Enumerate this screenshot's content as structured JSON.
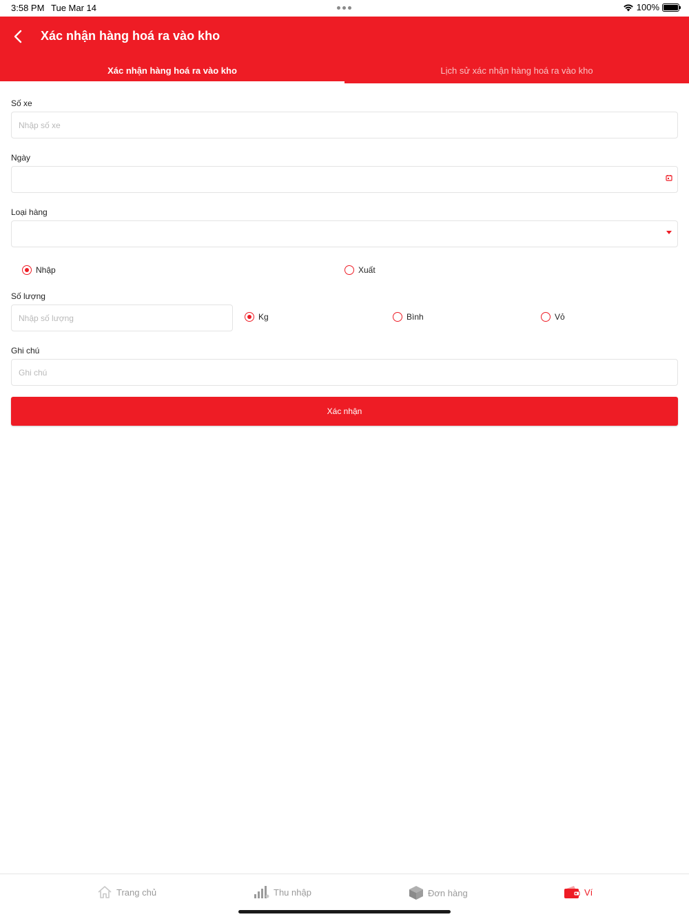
{
  "status": {
    "time": "3:58 PM",
    "date": "Tue Mar 14",
    "battery": "100%"
  },
  "header": {
    "title": "Xác nhận hàng hoá ra vào kho"
  },
  "tabs": [
    {
      "label": "Xác nhận hàng hoá ra vào kho",
      "active": true
    },
    {
      "label": "Lịch sử xác nhận hàng hoá ra vào kho",
      "active": false
    }
  ],
  "form": {
    "so_xe": {
      "label": "Số xe",
      "placeholder": "Nhập số xe",
      "value": ""
    },
    "ngay": {
      "label": "Ngày",
      "value": ""
    },
    "loai_hang": {
      "label": "Loại hàng",
      "value": ""
    },
    "direction": {
      "options": [
        "Nhập",
        "Xuất"
      ],
      "selected": "Nhập"
    },
    "so_luong": {
      "label": "Số lượng",
      "placeholder": "Nhập số lượng",
      "value": ""
    },
    "unit": {
      "options": [
        "Kg",
        "Bình",
        "Vỏ"
      ],
      "selected": "Kg"
    },
    "ghi_chu": {
      "label": "Ghi chú",
      "placeholder": "Ghi chú",
      "value": ""
    },
    "submit_label": "Xác nhận"
  },
  "bottom_nav": [
    {
      "label": "Trang chủ",
      "icon": "home-icon",
      "active": false
    },
    {
      "label": "Thu nhập",
      "icon": "income-chart-icon",
      "active": false
    },
    {
      "label": "Đơn hàng",
      "icon": "package-icon",
      "active": false
    },
    {
      "label": "Ví",
      "icon": "wallet-icon",
      "active": true
    }
  ],
  "colors": {
    "accent": "#ee1c25",
    "inactive_nav": "#9a9a9a"
  }
}
